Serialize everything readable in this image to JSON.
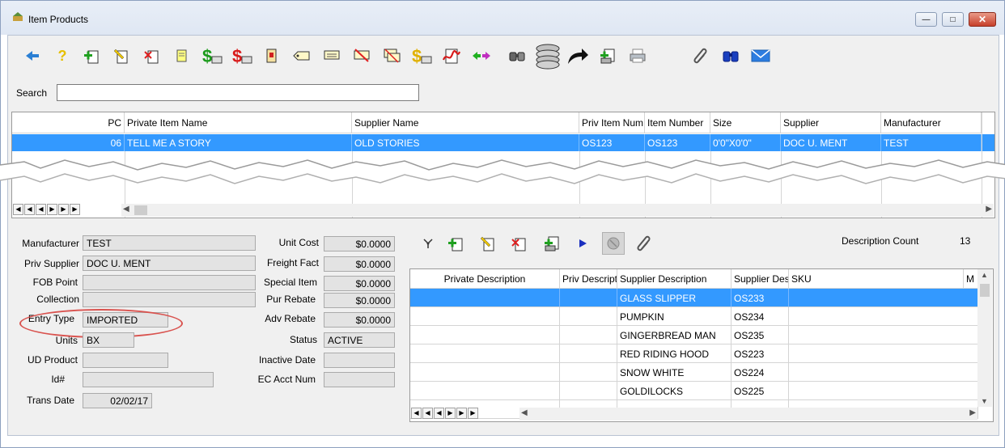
{
  "window": {
    "title": "Item Products"
  },
  "toolbar": {
    "icons": [
      "back-arrow-icon",
      "help-icon",
      "new-record-icon",
      "edit-record-icon",
      "delete-record-icon",
      "notes-icon",
      "price-icon",
      "price-red-icon",
      "tag-icon",
      "label-icon",
      "label-print-icon",
      "label-cancel-icon",
      "label-copy-icon",
      "cost-icon",
      "signature-icon",
      "transfer-icon",
      "binoculars-small-icon",
      "database-icon",
      "forward-arrow-icon",
      "add-copy-icon",
      "print-icon",
      "attachment-icon",
      "find-icon",
      "email-icon"
    ]
  },
  "search": {
    "label": "Search",
    "value": ""
  },
  "top_grid": {
    "columns": [
      "PC",
      "Private Item Name",
      "Supplier Name",
      "Priv Item Num",
      "Item Number",
      "Size",
      "Supplier",
      "Manufacturer"
    ],
    "rows": [
      [
        "06",
        "TELL ME A STORY",
        "OLD STORIES",
        "OS123",
        "OS123",
        "0'0\"X0'0\"",
        "DOC U. MENT",
        "TEST"
      ]
    ]
  },
  "form": {
    "manufacturer_label": "Manufacturer",
    "manufacturer": "TEST",
    "priv_supplier_label": "Priv Supplier",
    "priv_supplier": "DOC U. MENT",
    "fob_point_label": "FOB Point",
    "fob_point": "",
    "collection_label": "Collection",
    "collection": "",
    "entry_type_label": "Entry Type",
    "entry_type": "IMPORTED",
    "units_label": "Units",
    "units": "BX",
    "ud_product_label": "UD Product",
    "ud_product": "",
    "id_label": "Id#",
    "id": "",
    "trans_date_label": "Trans Date",
    "trans_date": "02/02/17",
    "unit_cost_label": "Unit Cost",
    "unit_cost": "$0.0000",
    "freight_fact_label": "Freight Fact",
    "freight_fact": "$0.0000",
    "special_item_label": "Special Item",
    "special_item": "$0.0000",
    "pur_rebate_label": "Pur Rebate",
    "pur_rebate": "$0.0000",
    "adv_rebate_label": "Adv Rebate",
    "adv_rebate": "$0.0000",
    "status_label": "Status",
    "status": "ACTIVE",
    "inactive_date_label": "Inactive Date",
    "inactive_date": "",
    "ec_acct_num_label": "EC Acct Num",
    "ec_acct_num": ""
  },
  "description": {
    "count_label": "Description Count",
    "count": "13",
    "columns": [
      "Private Description",
      "Priv Descript",
      "Supplier Description",
      "Supplier Des",
      "SKU",
      "M"
    ],
    "rows": [
      [
        "",
        "",
        "GLASS SLIPPER",
        "OS233",
        ""
      ],
      [
        "",
        "",
        "PUMPKIN",
        "OS234",
        ""
      ],
      [
        "",
        "",
        "GINGERBREAD MAN",
        "OS235",
        ""
      ],
      [
        "",
        "",
        "RED RIDING HOOD",
        "OS223",
        ""
      ],
      [
        "",
        "",
        "SNOW WHITE",
        "OS224",
        ""
      ],
      [
        "",
        "",
        "GOLDILOCKS",
        "OS225",
        ""
      ]
    ]
  },
  "colors": {
    "selection": "#3399ff",
    "highlight_oval": "#d9534f"
  }
}
